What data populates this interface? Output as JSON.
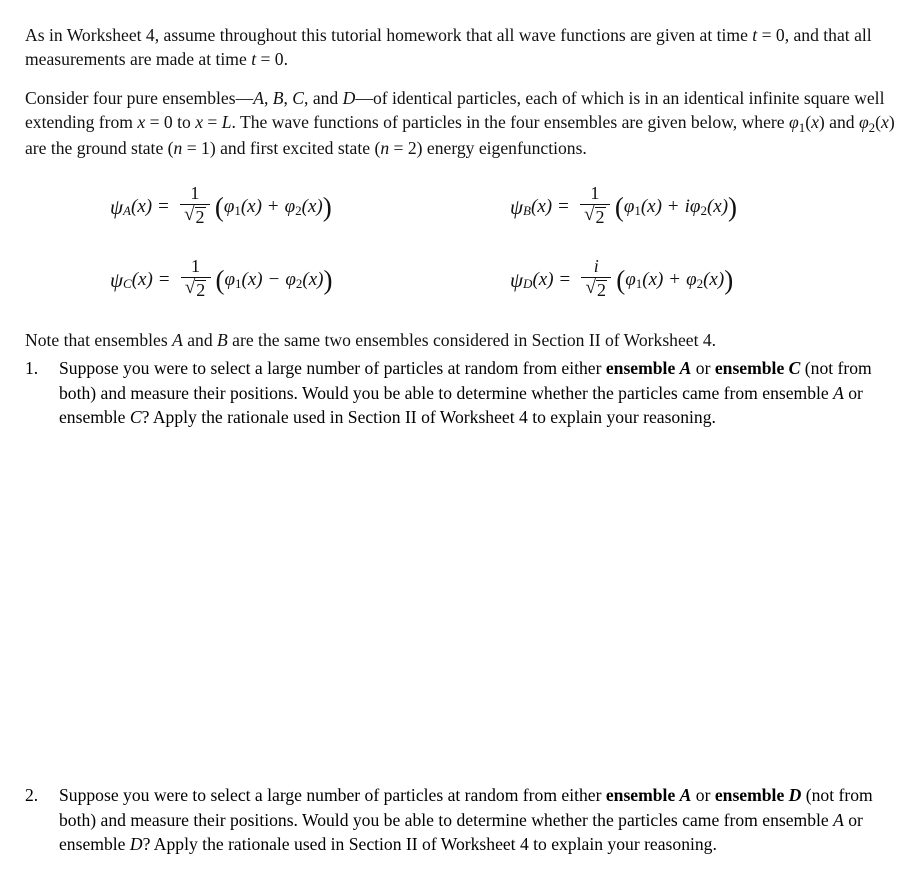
{
  "document": {
    "type": "physics-tutorial-homework",
    "intro_paragraph_1": "As in Worksheet 4, assume throughout this tutorial homework that all wave functions are given at time t = 0, and that all measurements are made at time t = 0.",
    "intro_paragraph_1_parts": {
      "a": "As in Worksheet 4, assume throughout this tutorial homework that all wave functions are given at time ",
      "t1": "t",
      "b": " = 0, and that all measurements are made at time ",
      "t2": "t",
      "c": " = 0."
    },
    "intro_paragraph_2_parts": {
      "a": "Consider four pure ensembles—",
      "A": "A",
      "b": ", ",
      "B": "B",
      "c": ", ",
      "C": "C",
      "d": ", and ",
      "D": "D",
      "e": "—of identical particles, each of which is in an identical infinite square well extending from ",
      "x1": "x",
      "f": " = 0 to ",
      "x2": "x",
      "g": " = ",
      "L": "L",
      "h": ".  The wave functions of particles in the four ensembles are given below, where ",
      "phi1": "φ",
      "phi1sub": "1",
      "i": "(",
      "x3": "x",
      "j": ") and ",
      "phi2": "φ",
      "phi2sub": "2",
      "k": "(",
      "x4": "x",
      "l": ") are the ground state (",
      "n1": "n",
      "m": " = 1) and first excited state (",
      "n2": "n",
      "n": " = 2) energy eigenfunctions."
    },
    "note_parts": {
      "a": "Note that ensembles ",
      "A": "A",
      "b": " and ",
      "B": "B",
      "c": " are the same two ensembles considered in Section II of Worksheet 4."
    }
  },
  "equations": [
    {
      "id": "psi-A",
      "label": "ψ",
      "subscript": "A",
      "arg": "(x)",
      "equals": "=",
      "numerator": "1",
      "numerator_italic": false,
      "denominator": "√2",
      "denominator_radicand": "2",
      "open_paren": "(",
      "term1": "φ",
      "term1_sub": "1",
      "term1_arg": "(x)",
      "operator": "+",
      "imaginary_unit": "",
      "term2": "φ",
      "term2_sub": "2",
      "term2_arg": "(x)",
      "close_paren": ")",
      "plain": "ψA(x) = 1/√2 (φ1(x) + φ2(x))"
    },
    {
      "id": "psi-B",
      "label": "ψ",
      "subscript": "B",
      "arg": "(x)",
      "equals": "=",
      "numerator": "1",
      "numerator_italic": false,
      "denominator": "√2",
      "denominator_radicand": "2",
      "open_paren": "(",
      "term1": "φ",
      "term1_sub": "1",
      "term1_arg": "(x)",
      "operator": "+",
      "imaginary_unit": "i",
      "term2": "φ",
      "term2_sub": "2",
      "term2_arg": "(x)",
      "close_paren": ")",
      "plain": "ψB(x) = 1/√2 (φ1(x) + iφ2(x))"
    },
    {
      "id": "psi-C",
      "label": "ψ",
      "subscript": "C",
      "arg": "(x)",
      "equals": "=",
      "numerator": "1",
      "numerator_italic": false,
      "denominator": "√2",
      "denominator_radicand": "2",
      "open_paren": "(",
      "term1": "φ",
      "term1_sub": "1",
      "term1_arg": "(x)",
      "operator": "−",
      "imaginary_unit": "",
      "term2": "φ",
      "term2_sub": "2",
      "term2_arg": "(x)",
      "close_paren": ")",
      "plain": "ψC(x) = 1/√2 (φ1(x) − φ2(x))"
    },
    {
      "id": "psi-D",
      "label": "ψ",
      "subscript": "D",
      "arg": "(x)",
      "equals": "=",
      "numerator": "i",
      "numerator_italic": true,
      "denominator": "√2",
      "denominator_radicand": "2",
      "open_paren": "(",
      "term1": "φ",
      "term1_sub": "1",
      "term1_arg": "(x)",
      "operator": "+",
      "imaginary_unit": "",
      "term2": "φ",
      "term2_sub": "2",
      "term2_arg": "(x)",
      "close_paren": ")",
      "plain": "ψD(x) = i/√2 (φ1(x) + φ2(x))"
    }
  ],
  "questions": [
    {
      "number": "1.",
      "parts": {
        "a": "Suppose you were to select a large number of particles at random from either ",
        "bold1": "ensemble ",
        "boldital1": "A",
        "b": " or ",
        "bold2": "ensemble ",
        "boldital2": "C",
        "c": " (not from both) and measure their positions.  Would you be able to determine whether the particles came from ensemble ",
        "ital1": "A",
        "d": " or ensemble ",
        "ital2": "C",
        "e": "?  Apply the rationale used in Section II of Worksheet 4 to explain your reasoning."
      },
      "plain": "Suppose you were to select a large number of particles at random from either ensemble A or ensemble C (not from both) and measure their positions.  Would you be able to determine whether the particles came from ensemble A or ensemble C?  Apply the rationale used in Section II of Worksheet 4 to explain your reasoning."
    },
    {
      "number": "2.",
      "parts": {
        "a": "Suppose you were to select a large number of particles at random from either ",
        "bold1": "ensemble ",
        "boldital1": "A",
        "b": " or ",
        "bold2": "ensemble ",
        "boldital2": "D",
        "c": " (not from both) and measure their positions.  Would you be able to determine whether the particles came from ensemble ",
        "ital1": "A",
        "d": " or ensemble ",
        "ital2": "D",
        "e": "?  Apply the rationale used in Section II of Worksheet 4 to explain your reasoning."
      },
      "plain": "Suppose you were to select a large number of particles at random from either ensemble A or ensemble D (not from both) and measure their positions.  Would you be able to determine whether the particles came from ensemble A or ensemble D?  Apply the rationale used in Section II of Worksheet 4 to explain your reasoning."
    }
  ]
}
